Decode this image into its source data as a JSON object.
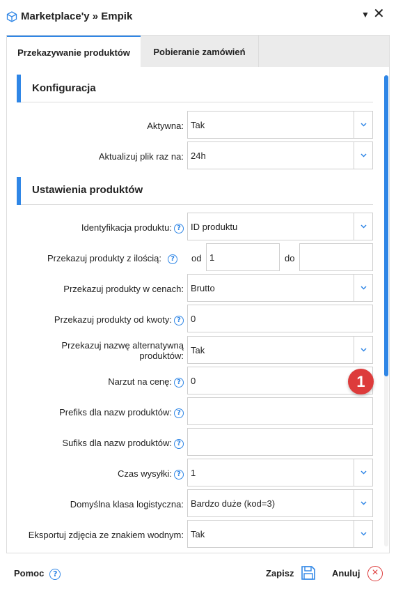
{
  "window": {
    "title": "Marketplace'y » Empik"
  },
  "tabs": [
    {
      "label": "Przekazywanie produktów",
      "active": true
    },
    {
      "label": "Pobieranie zamówień",
      "active": false
    }
  ],
  "sections": {
    "config": {
      "title": "Konfiguracja"
    },
    "products": {
      "title": "Ustawienia produktów"
    }
  },
  "fields": {
    "aktywna": {
      "label": "Aktywna:",
      "value": "Tak"
    },
    "aktualizuj": {
      "label": "Aktualizuj plik raz na:",
      "value": "24h"
    },
    "identyfikacja": {
      "label": "Identyfikacja produktu:",
      "value": "ID produktu"
    },
    "ilosc": {
      "label": "Przekazuj produkty z ilością:",
      "from_label": "od",
      "from_value": "1",
      "to_label": "do",
      "to_value": ""
    },
    "ceny": {
      "label": "Przekazuj produkty w cenach:",
      "value": "Brutto"
    },
    "od_kwoty": {
      "label": "Przekazuj produkty od kwoty:",
      "value": "0"
    },
    "nazwa_alt": {
      "label_line1": "Przekazuj nazwę alternatywną",
      "label_line2": "produktów:",
      "value": "Tak"
    },
    "narzut": {
      "label": "Narzut na cenę:",
      "value": "0"
    },
    "prefiks": {
      "label": "Prefiks dla nazw produktów:",
      "value": ""
    },
    "sufiks": {
      "label": "Sufiks dla nazw produktów:",
      "value": ""
    },
    "czas": {
      "label": "Czas wysyłki:",
      "value": "1"
    },
    "klasa": {
      "label": "Domyślna klasa logistyczna:",
      "value": "Bardzo duże (kod=3)"
    },
    "zdjecia": {
      "label": "Eksportuj zdjęcia ze znakiem wodnym:",
      "value": "Tak"
    }
  },
  "badge": {
    "value": "1"
  },
  "footer": {
    "help_label": "Pomoc",
    "save_label": "Zapisz",
    "cancel_label": "Anuluj"
  },
  "icons": {
    "window": "cube-icon",
    "help": "question-circle-icon",
    "dropdown": "chevron-down-icon",
    "save": "floppy-disk-icon",
    "cancel": "close-circle-icon"
  },
  "colors": {
    "accent": "#2f86e6",
    "danger": "#dd3b3b",
    "border": "#cfcfcf"
  }
}
